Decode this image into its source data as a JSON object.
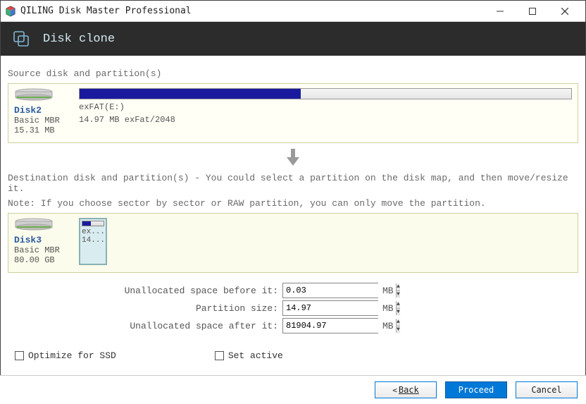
{
  "window": {
    "title": "QILING Disk Master Professional"
  },
  "banner": {
    "title": "Disk clone"
  },
  "source": {
    "heading": "Source disk and partition(s)",
    "disk_name": "Disk2",
    "disk_type": "Basic MBR",
    "disk_size": "15.31 MB",
    "partition_label": "exFAT(E:)",
    "partition_detail": "14.97 MB exFat/2048"
  },
  "dest": {
    "heading": "Destination disk and partition(s) - You could select a partition on the disk map, and then move/resize it.",
    "note": "Note: If you choose sector by sector or RAW partition, you can only move the partition.",
    "disk_name": "Disk3",
    "disk_type": "Basic MBR",
    "disk_size": "80.00 GB",
    "partition_label_small_1": "ex...",
    "partition_label_small_2": "14..."
  },
  "form": {
    "space_before_label": "Unallocated space before it:",
    "space_before_value": "0.03",
    "partition_size_label": "Partition size:",
    "partition_size_value": "14.97",
    "space_after_label": "Unallocated space after it:",
    "space_after_value": "81904.97",
    "unit": "MB"
  },
  "checks": {
    "optimize": "Optimize for SSD",
    "set_active": "Set active"
  },
  "buttons": {
    "back": "Back",
    "proceed": "Proceed",
    "cancel": "Cancel"
  }
}
